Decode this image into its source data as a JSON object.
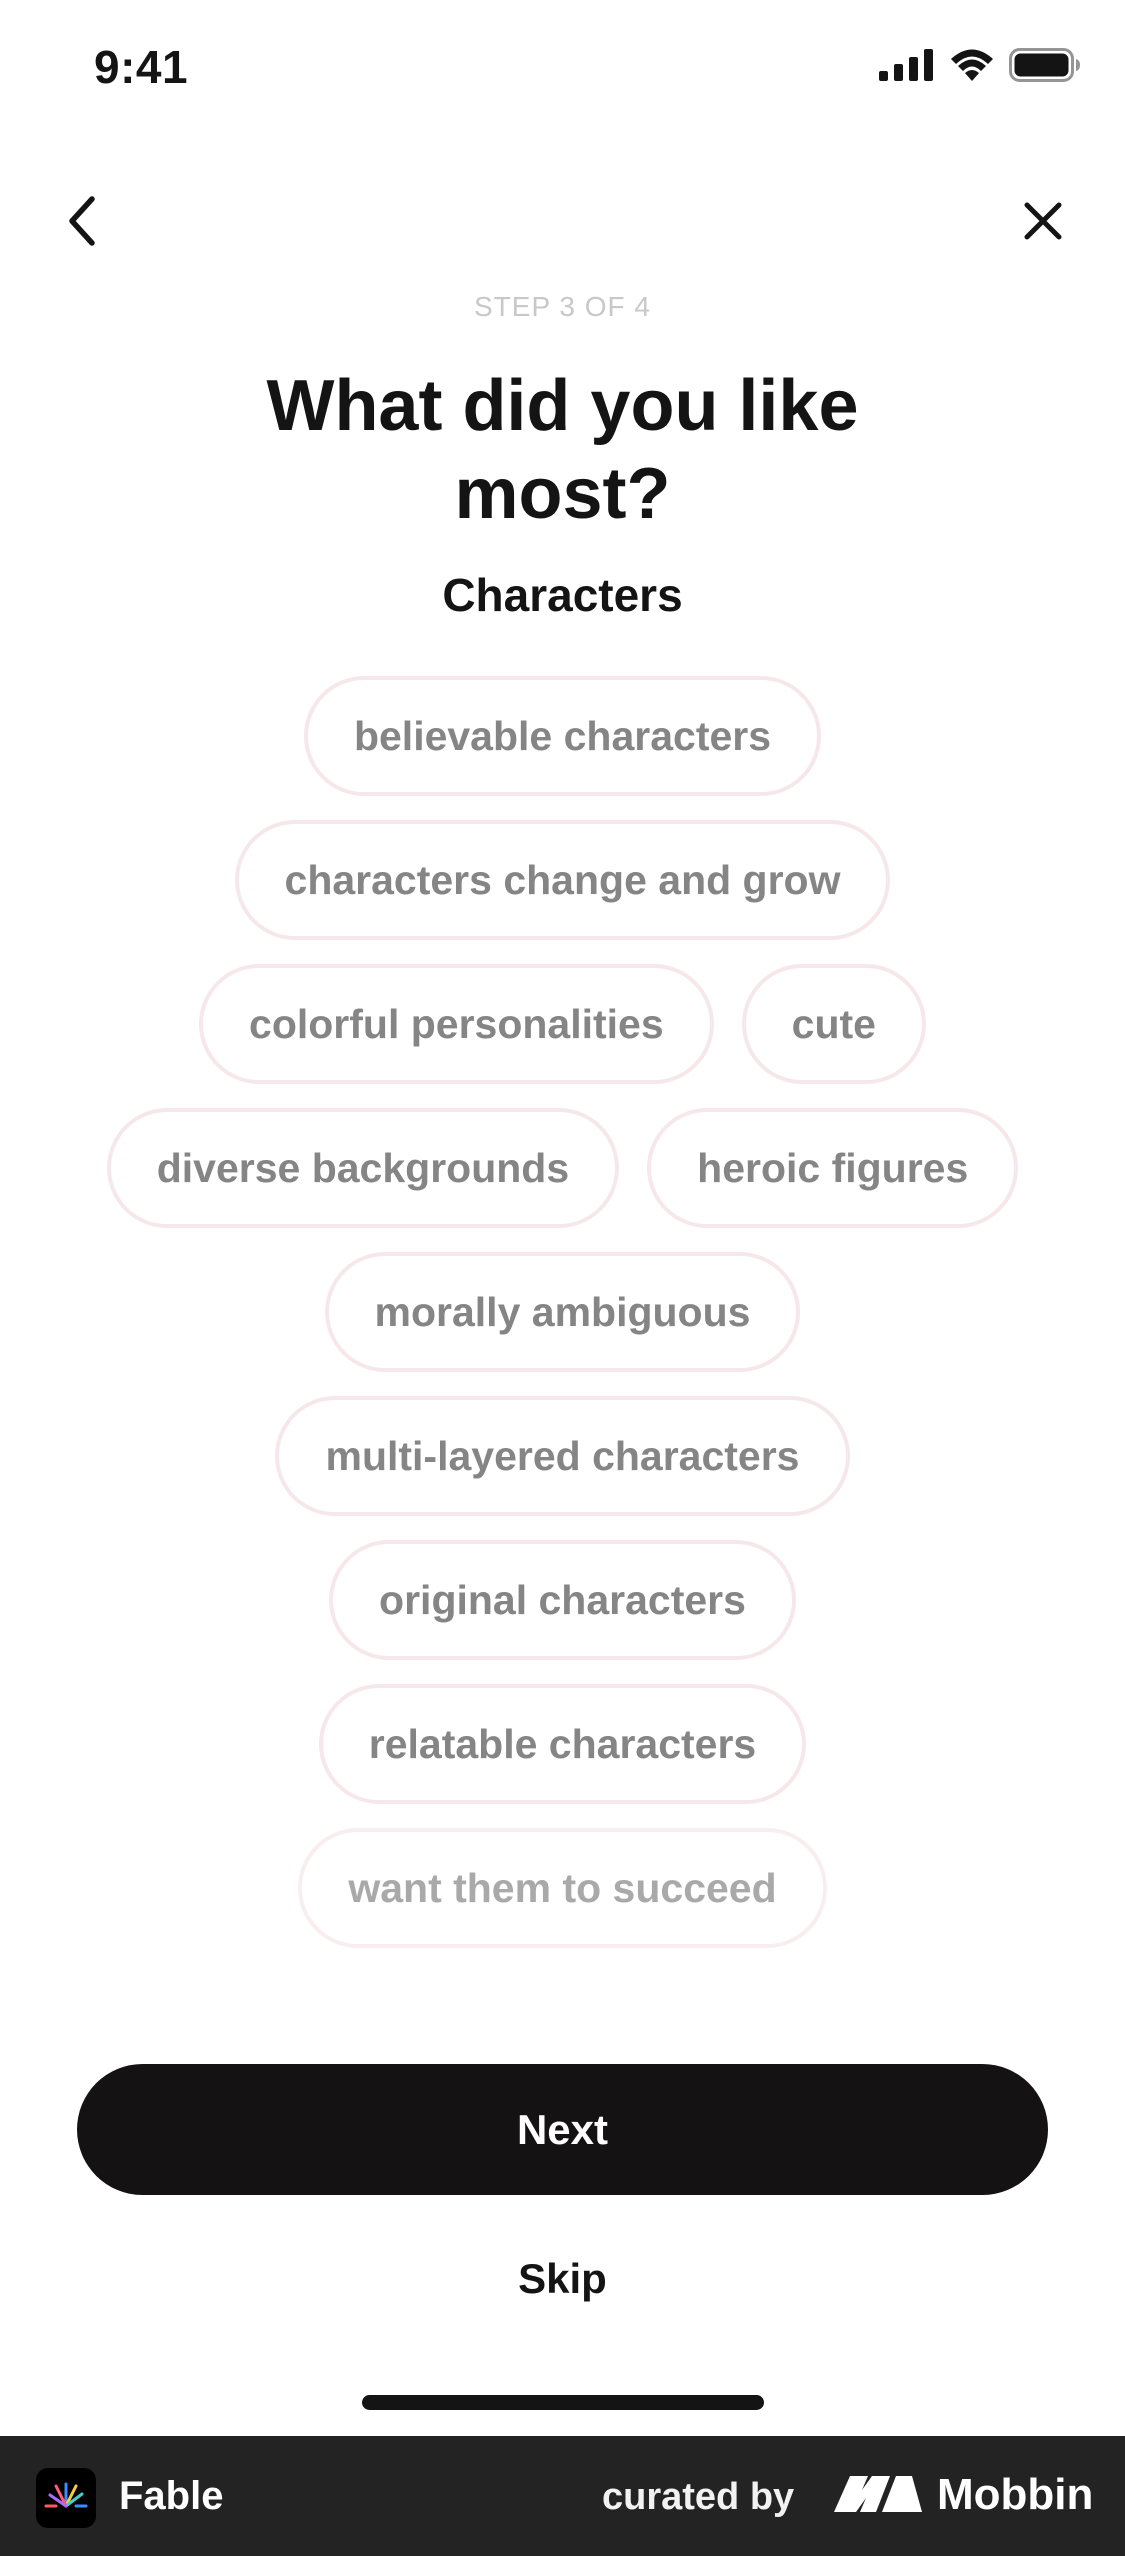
{
  "status_bar": {
    "time": "9:41",
    "icons": [
      "signal-icon",
      "wifi-icon",
      "battery-icon"
    ]
  },
  "nav": {
    "back_icon": "chevron-left-icon",
    "close_icon": "close-icon"
  },
  "step_label": "STEP 3 OF 4",
  "title": "What did you like most?",
  "category": "Characters",
  "chips": [
    "believable characters",
    "characters change and grow",
    "colorful personalities",
    "cute",
    "diverse backgrounds",
    "heroic figures",
    "morally ambiguous",
    "multi-layered characters",
    "original characters",
    "relatable characters",
    "want them to succeed"
  ],
  "actions": {
    "next_label": "Next",
    "skip_label": "Skip"
  },
  "footer": {
    "app_name": "Fable",
    "curated_by": "curated by",
    "brand": "Mobbin"
  },
  "colors": {
    "primary_button": "#141213",
    "chip_border": "#f6e8ea",
    "chip_text": "#858585",
    "step_text": "#c8c8c8",
    "footer_bg": "#232323"
  }
}
